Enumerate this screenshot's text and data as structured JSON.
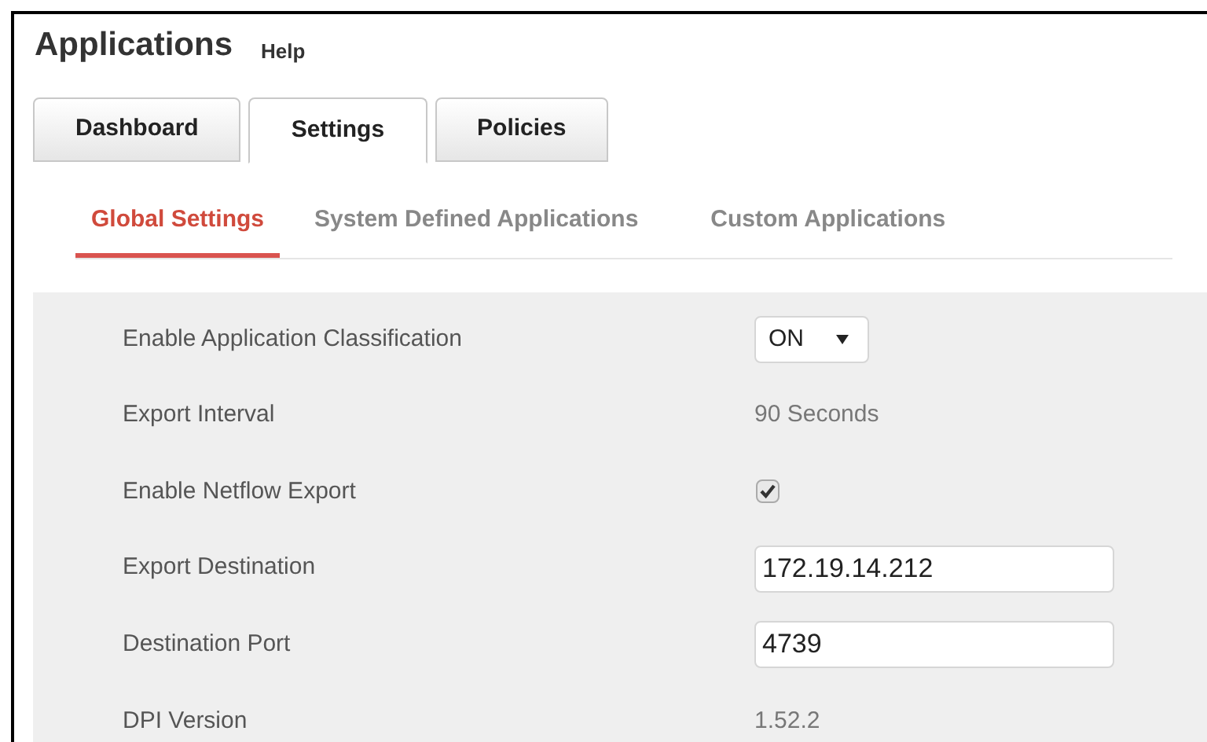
{
  "header": {
    "title": "Applications",
    "help": "Help"
  },
  "tabs": [
    {
      "label": "Dashboard",
      "selected": false
    },
    {
      "label": "Settings",
      "selected": true
    },
    {
      "label": "Policies",
      "selected": false
    }
  ],
  "subtabs": [
    {
      "label": "Global Settings",
      "selected": true
    },
    {
      "label": "System Defined Applications",
      "selected": false
    },
    {
      "label": "Custom Applications",
      "selected": false
    }
  ],
  "settings": [
    {
      "kind": "select",
      "label": "Enable Application Classification",
      "value": "ON"
    },
    {
      "kind": "text",
      "label": "Export Interval",
      "value": "90 Seconds"
    },
    {
      "kind": "checkbox",
      "label": "Enable Netflow Export",
      "checked": true
    },
    {
      "kind": "input",
      "label": "Export Destination",
      "value": "172.19.14.212"
    },
    {
      "kind": "input",
      "label": "Destination Port",
      "value": "4739"
    },
    {
      "kind": "text",
      "label": "DPI Version",
      "value": "1.52.2"
    }
  ]
}
